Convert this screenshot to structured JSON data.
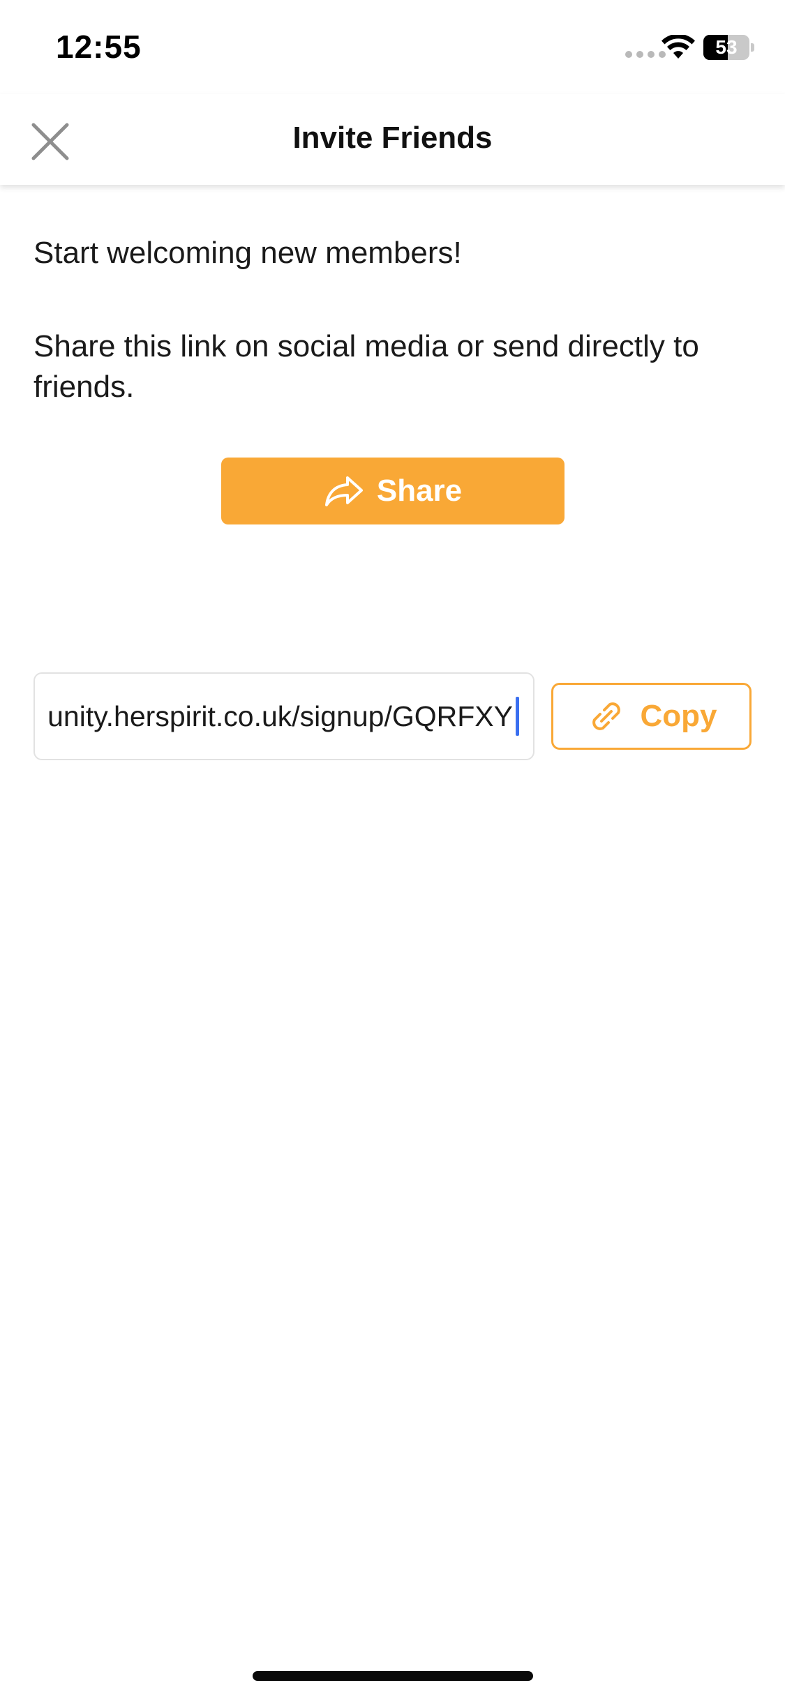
{
  "status_bar": {
    "time": "12:55",
    "battery_level": "53",
    "battery_fraction": 0.53
  },
  "header": {
    "title": "Invite Friends",
    "close_icon": "close-icon"
  },
  "content": {
    "intro": "Start welcoming new members!",
    "instructions": "Share this link on social media or send directly to friends.",
    "share_label": "Share",
    "share_icon": "share-arrow-icon",
    "link_value": "unity.herspirit.co.uk/signup/GQRFXY",
    "copy_label": "Copy",
    "copy_icon": "link-icon"
  },
  "colors": {
    "accent": "#f9a836",
    "caret": "#3a6ff0"
  }
}
